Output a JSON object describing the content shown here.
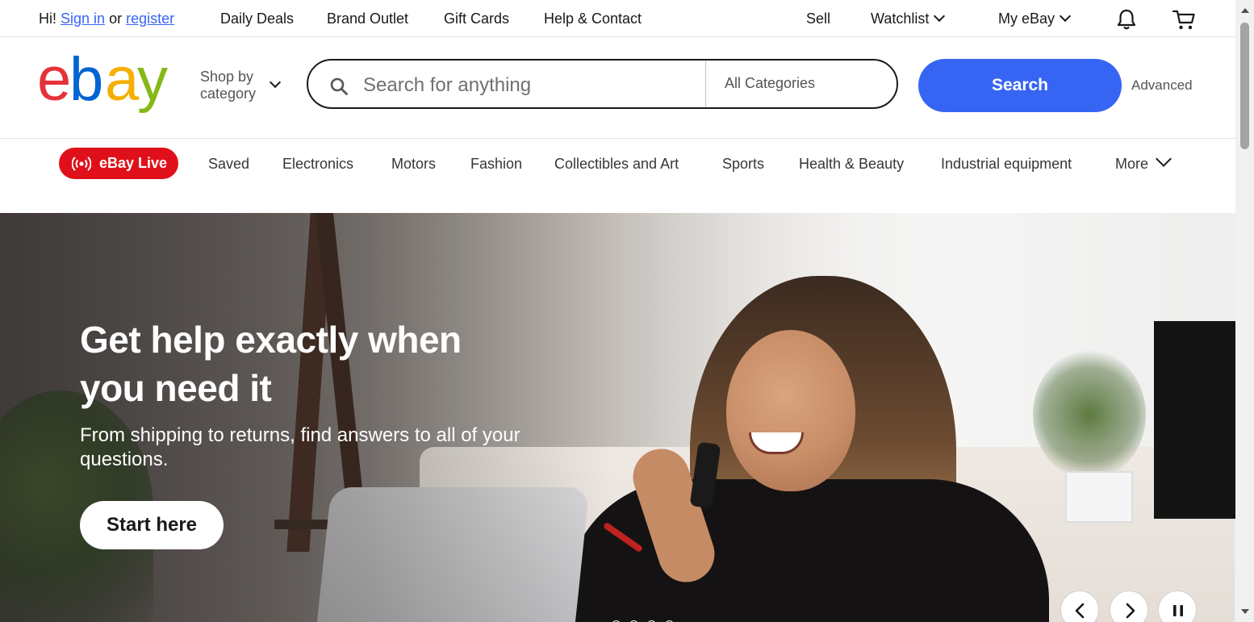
{
  "topbar": {
    "greeting_prefix": "Hi!",
    "sign_in": "Sign in",
    "or": "or",
    "register": "register",
    "links": [
      "Daily Deals",
      "Brand Outlet",
      "Gift Cards",
      "Help & Contact"
    ],
    "sell": "Sell",
    "watchlist": "Watchlist",
    "my_ebay": "My eBay",
    "icons": {
      "notifications": "bell-icon",
      "cart": "cart-icon"
    }
  },
  "header": {
    "logo_letters": [
      "e",
      "b",
      "a",
      "y"
    ],
    "logo_colors": [
      "#e53238",
      "#0064d2",
      "#f5af02",
      "#86b817"
    ],
    "shop_by_line1": "Shop by",
    "shop_by_line2": "category",
    "search_placeholder": "Search for anything",
    "category_select": "All Categories",
    "search_button": "Search",
    "advanced": "Advanced"
  },
  "nav": {
    "live_label": "eBay Live",
    "items": [
      "Saved",
      "Electronics",
      "Motors",
      "Fashion",
      "Collectibles and Art",
      "Sports",
      "Health & Beauty",
      "Industrial equipment"
    ],
    "more": "More"
  },
  "hero": {
    "title": "Get help exactly when you need it",
    "subtitle": "From shipping to returns, find answers to all of your questions.",
    "cta": "Start here",
    "controls": [
      "previous-icon",
      "next-icon",
      "pause-icon"
    ],
    "slide_count": 4
  },
  "colors": {
    "accent_blue": "#3665f3",
    "live_red": "#e0101a",
    "text": "#191919"
  }
}
